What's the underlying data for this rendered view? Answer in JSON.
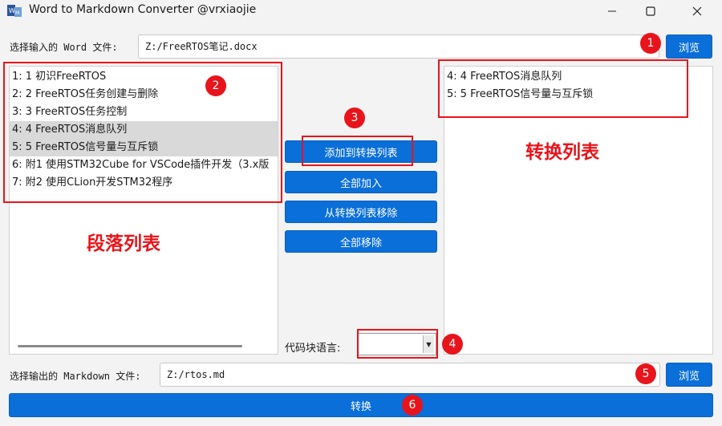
{
  "window": {
    "title": "Word to Markdown Converter @vrxiaojie"
  },
  "input_file": {
    "label": "选择输入的 Word 文件:",
    "value": "Z:/FreeRTOS笔记.docx",
    "browse_label": "浏览"
  },
  "paragraph_list": {
    "items": [
      {
        "text": "1: 1 初识FreeRTOS",
        "selected": false
      },
      {
        "text": "2: 2 FreeRTOS任务创建与删除",
        "selected": false
      },
      {
        "text": "3: 3 FreeRTOS任务控制",
        "selected": false
      },
      {
        "text": "4: 4 FreeRTOS消息队列",
        "selected": true
      },
      {
        "text": "5: 5 FreeRTOS信号量与互斥锁",
        "selected": true
      },
      {
        "text": "6: 附1 使用STM32Cube for VSCode插件开发（3.x版",
        "selected": false
      },
      {
        "text": "7: 附2 使用CLion开发STM32程序",
        "selected": false
      }
    ]
  },
  "actions": {
    "add_label": "添加到转换列表",
    "add_all_label": "全部加入",
    "remove_label": "从转换列表移除",
    "remove_all_label": "全部移除",
    "lang_label": "代码块语言:",
    "lang_value": ""
  },
  "convert_list": {
    "items": [
      {
        "text": "4: 4 FreeRTOS消息队列"
      },
      {
        "text": "5: 5 FreeRTOS信号量与互斥锁"
      }
    ]
  },
  "output_file": {
    "label": "选择输出的 Markdown 文件:",
    "value": "Z:/rtos.md",
    "browse_label": "浏览"
  },
  "convert_button": {
    "label": "转换"
  },
  "annotations": {
    "paragraph_list_caption": "段落列表",
    "convert_list_caption": "转换列表",
    "markers": [
      "1",
      "2",
      "3",
      "4",
      "5",
      "6"
    ],
    "color": "#e8141b"
  },
  "colors": {
    "accent": "#0a6fd8",
    "selected_row": "#d9d9d9"
  }
}
